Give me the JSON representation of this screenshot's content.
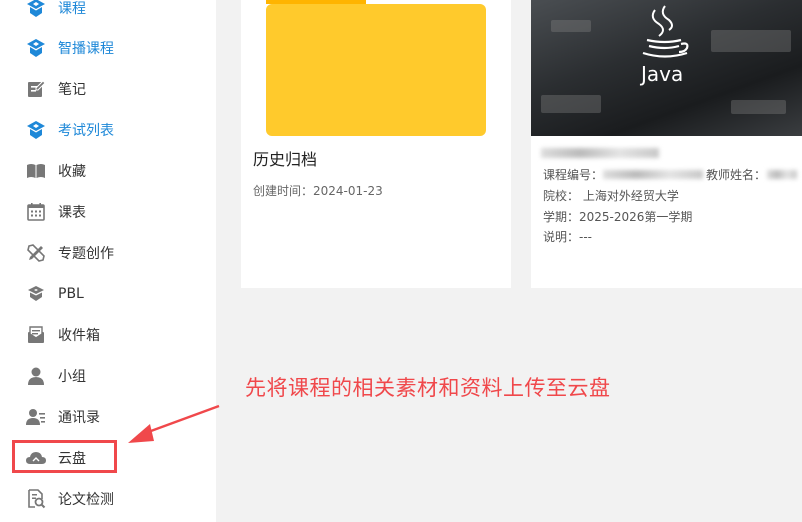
{
  "sidebar": {
    "items": [
      {
        "label": "课程",
        "icon": "course-icon"
      },
      {
        "label": "智播课程",
        "icon": "smart-course-icon"
      },
      {
        "label": "笔记",
        "icon": "note-icon"
      },
      {
        "label": "考试列表",
        "icon": "exam-icon"
      },
      {
        "label": "收藏",
        "icon": "book-icon"
      },
      {
        "label": "课表",
        "icon": "calendar-icon"
      },
      {
        "label": "专题创作",
        "icon": "pen-ruler-icon"
      },
      {
        "label": "PBL",
        "icon": "pbl-icon"
      },
      {
        "label": "收件箱",
        "icon": "inbox-icon"
      },
      {
        "label": "小组",
        "icon": "user-icon"
      },
      {
        "label": "通讯录",
        "icon": "contact-icon"
      },
      {
        "label": "云盘",
        "icon": "cloud-icon"
      },
      {
        "label": "论文检测",
        "icon": "paper-check-icon"
      }
    ]
  },
  "cards": {
    "archive": {
      "title": "历史归档",
      "created": "创建时间：2024-01-23"
    },
    "java": {
      "banner_text": "Java",
      "course_no_label": "课程编号：",
      "teacher_label": "教师姓名：",
      "school": "院校： 上海对外经贸大学",
      "term": "学期：2025-2026第一学期",
      "desc": "说明：---"
    }
  },
  "annotation": {
    "text": "先将课程的相关素材和资料上传至云盘"
  },
  "colors": {
    "accent_blue": "#1e88d8",
    "folder_yellow": "#ffca2c",
    "annotation_red": "#f0484b"
  }
}
